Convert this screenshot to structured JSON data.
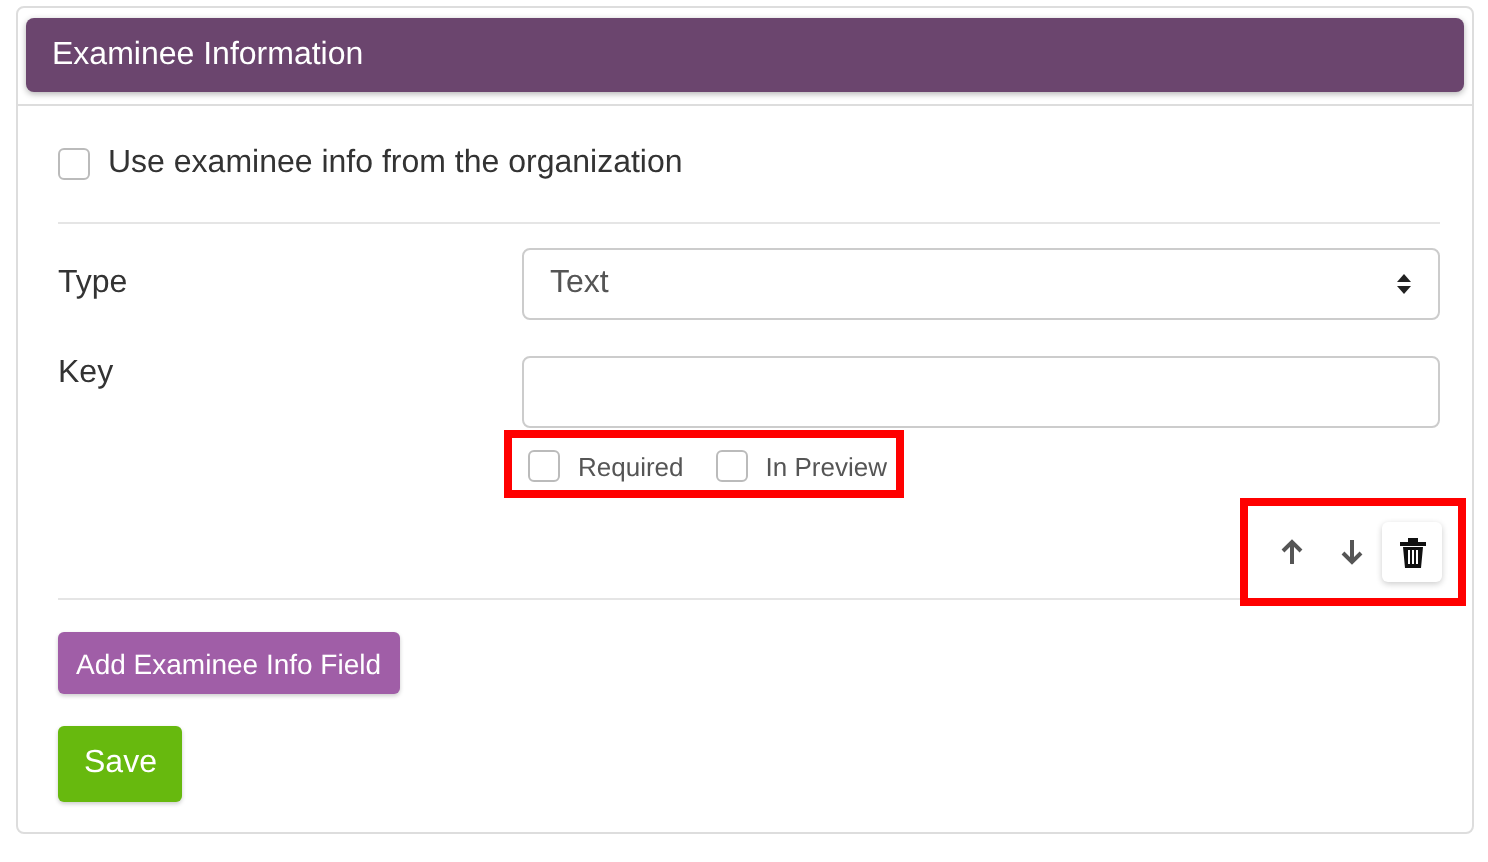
{
  "panel": {
    "title": "Examinee Information"
  },
  "use_org_info": {
    "label": "Use examinee info from the organization",
    "checked": false
  },
  "fields": [
    {
      "label": "Type",
      "kind": "select",
      "value": "Text"
    },
    {
      "label": "Key",
      "kind": "input"
    }
  ],
  "options": {
    "highlighted": true,
    "items": [
      {
        "label": "Required",
        "checked": false
      },
      {
        "label": "In Preview",
        "checked": false
      }
    ]
  },
  "actions": {
    "highlighted": true,
    "items": [
      {
        "kind": "up"
      },
      {
        "kind": "down"
      },
      {
        "kind": "delete"
      }
    ]
  },
  "buttons": [
    {
      "label": "Add Examinee Info Field",
      "kind": "secondary"
    },
    {
      "label": "Save",
      "kind": "primary"
    }
  ]
}
